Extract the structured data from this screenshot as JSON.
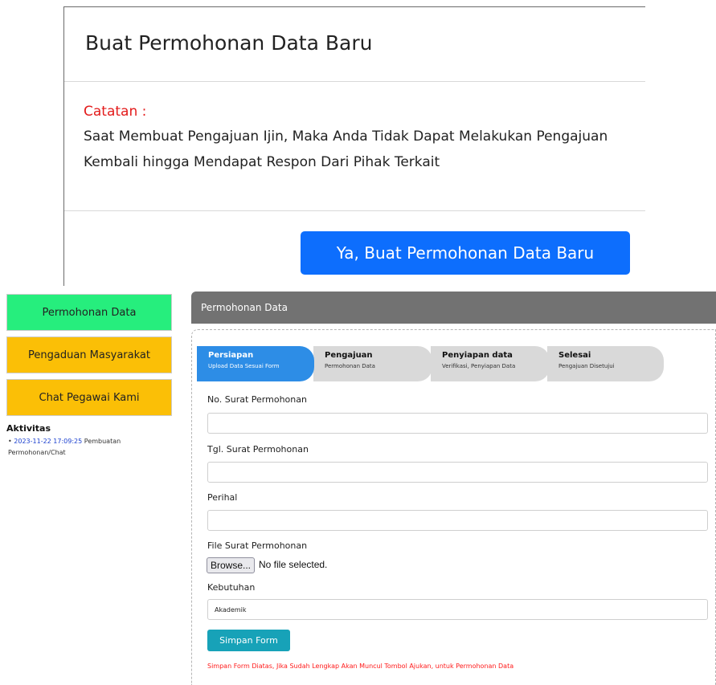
{
  "modal": {
    "title": "Buat Permohonan Data Baru",
    "note_label": "Catatan :",
    "note_text": "Saat Membuat Pengajuan Ijin, Maka Anda Tidak Dapat Melakukan Pengajuan Kembali hingga Mendapat Respon Dari Pihak Terkait",
    "confirm_button": "Ya, Buat Permohonan Data Baru"
  },
  "sidebar": {
    "items": [
      {
        "label": "Permohonan Data",
        "color": "#26ee7d"
      },
      {
        "label": "Pengaduan Masyarakat",
        "color": "#fbbf06"
      },
      {
        "label": "Chat Pegawai Kami",
        "color": "#fbbf06"
      }
    ],
    "activity": {
      "title": "Aktivitas",
      "entries": [
        {
          "bullet": "•",
          "time": "2023-11-22 17:09:25",
          "text": "Pembuatan Permohonan/Chat"
        }
      ]
    }
  },
  "panel": {
    "title": "Permohonan Data",
    "steps": [
      {
        "title": "Persiapan",
        "subtitle": "Upload Data Sesuai Form",
        "active": true
      },
      {
        "title": "Pengajuan",
        "subtitle": "Permohonan Data",
        "active": false
      },
      {
        "title": "Penyiapan data",
        "subtitle": "Verifikasi, Penyiapan Data",
        "active": false
      },
      {
        "title": "Selesai",
        "subtitle": "Pengajuan Disetujui",
        "active": false
      }
    ],
    "form": {
      "no_surat_label": "No. Surat Permohonan",
      "no_surat_value": "",
      "tgl_surat_label": "Tgl. Surat Permohonan",
      "tgl_surat_value": "",
      "perihal_label": "Perihal",
      "perihal_value": "",
      "file_label": "File Surat Permohonan",
      "browse_label": "Browse...",
      "no_file_text": "No file selected.",
      "kebutuhan_label": "Kebutuhan",
      "kebutuhan_value": "Akademik",
      "save_button": "Simpan Form",
      "warning": "Simpan Form Diatas, Jika Sudah Lengkap Akan Muncul Tombol Ajukan, untuk Permohonan Data"
    }
  }
}
